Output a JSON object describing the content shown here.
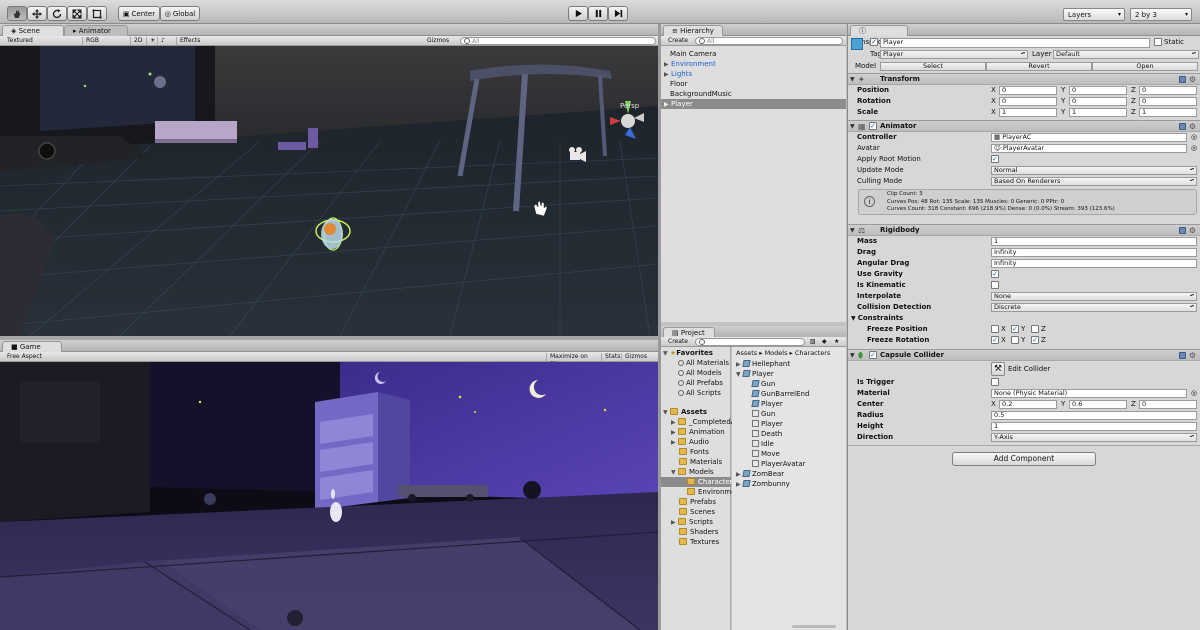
{
  "toolbar": {
    "tools": [
      "hand-icon",
      "move-icon",
      "rotate-icon",
      "scale-icon",
      "rect-icon"
    ],
    "pivot_label": "Center",
    "space_label": "Global",
    "layers_label": "Layers",
    "layout_label": "2 by 3"
  },
  "scene": {
    "tab_label": "Scene",
    "animator_tab": "Animator",
    "shading": "Textured",
    "render_mode": "RGB",
    "mode_2d": "2D",
    "effects": "Effects",
    "gizmos": "Gizmos",
    "search_placeholder": "All",
    "persp_label": "Persp"
  },
  "game": {
    "tab_label": "Game",
    "aspect": "Free Aspect",
    "maximize": "Maximize on Play",
    "stats": "Stats",
    "gizmos": "Gizmos"
  },
  "hierarchy": {
    "tab_label": "Hierarchy",
    "create_label": "Create",
    "search_placeholder": "All",
    "items": [
      "Main Camera",
      "Environment",
      "Lights",
      "Floor",
      "BackgroundMusic",
      "Player"
    ]
  },
  "project": {
    "tab_label": "Project",
    "create_label": "Create",
    "favorites_label": "Favorites",
    "favorites": [
      "All Materials",
      "All Models",
      "All Prefabs",
      "All Scripts"
    ],
    "assets_label": "Assets",
    "folders": [
      "_CompletedA",
      "Animation",
      "Audio",
      "Fonts",
      "Materials",
      "Models",
      "Character",
      "Environme",
      "Prefabs",
      "Scenes",
      "Scripts",
      "Shaders",
      "Textures"
    ],
    "breadcrumb": [
      "Assets",
      "Models",
      "Characters"
    ],
    "files": [
      "Hellephant",
      "Player",
      "Gun",
      "GunBarrelEnd",
      "Player",
      "Gun",
      "Player",
      "Death",
      "Idle",
      "Move",
      "PlayerAvatar",
      "ZomBear",
      "Zombunny"
    ]
  },
  "inspector": {
    "tab_label": "Inspector",
    "object_name": "Player",
    "static_label": "Static",
    "tag_label": "Tag",
    "tag_value": "Player",
    "layer_label": "Layer",
    "layer_value": "Default",
    "model_label": "Model",
    "model_buttons": [
      "Select",
      "Revert",
      "Open"
    ],
    "transform": {
      "title": "Transform",
      "position_label": "Position",
      "position": [
        "0",
        "0",
        "0"
      ],
      "rotation_label": "Rotation",
      "rotation": [
        "0",
        "0",
        "0"
      ],
      "scale_label": "Scale",
      "scale": [
        "1",
        "1",
        "1"
      ],
      "axes": [
        "X",
        "Y",
        "Z"
      ]
    },
    "animator": {
      "title": "Animator",
      "controller_label": "Controller",
      "controller": "PlayerAC",
      "avatar_label": "Avatar",
      "avatar": "PlayerAvatar",
      "root_motion_label": "Apply Root Motion",
      "update_mode_label": "Update Mode",
      "update_mode": "Normal",
      "culling_mode_label": "Culling Mode",
      "culling_mode": "Based On Renderers",
      "info": [
        "Clip Count: 3",
        "Curves Pos: 48 Rot: 135 Scale: 135 Muscles: 0 Generic: 0 PPtr: 0",
        "Curves Count: 318 Constant: 696 (218.9%) Dense: 0 (0.0%) Stream: 393 (123.6%)"
      ]
    },
    "rigidbody": {
      "title": "Rigidbody",
      "mass_label": "Mass",
      "mass": "1",
      "drag_label": "Drag",
      "drag": "Infinity",
      "angular_drag_label": "Angular Drag",
      "angular_drag": "Infinity",
      "use_gravity_label": "Use Gravity",
      "is_kinematic_label": "Is Kinematic",
      "interpolate_label": "Interpolate",
      "interpolate": "None",
      "collision_label": "Collision Detection",
      "collision": "Discrete",
      "constraints_label": "Constraints",
      "freeze_pos_label": "Freeze Position",
      "freeze_rot_label": "Freeze Rotation"
    },
    "capsule": {
      "title": "Capsule Collider",
      "edit_label": "Edit Collider",
      "trigger_label": "Is Trigger",
      "material_label": "Material",
      "material": "None (Physic Material)",
      "center_label": "Center",
      "center": [
        "0.2",
        "0.6",
        "0"
      ],
      "radius_label": "Radius",
      "radius": "0.5",
      "height_label": "Height",
      "height": "1",
      "direction_label": "Direction",
      "direction": "Y-Axis"
    },
    "add_component": "Add Component"
  }
}
